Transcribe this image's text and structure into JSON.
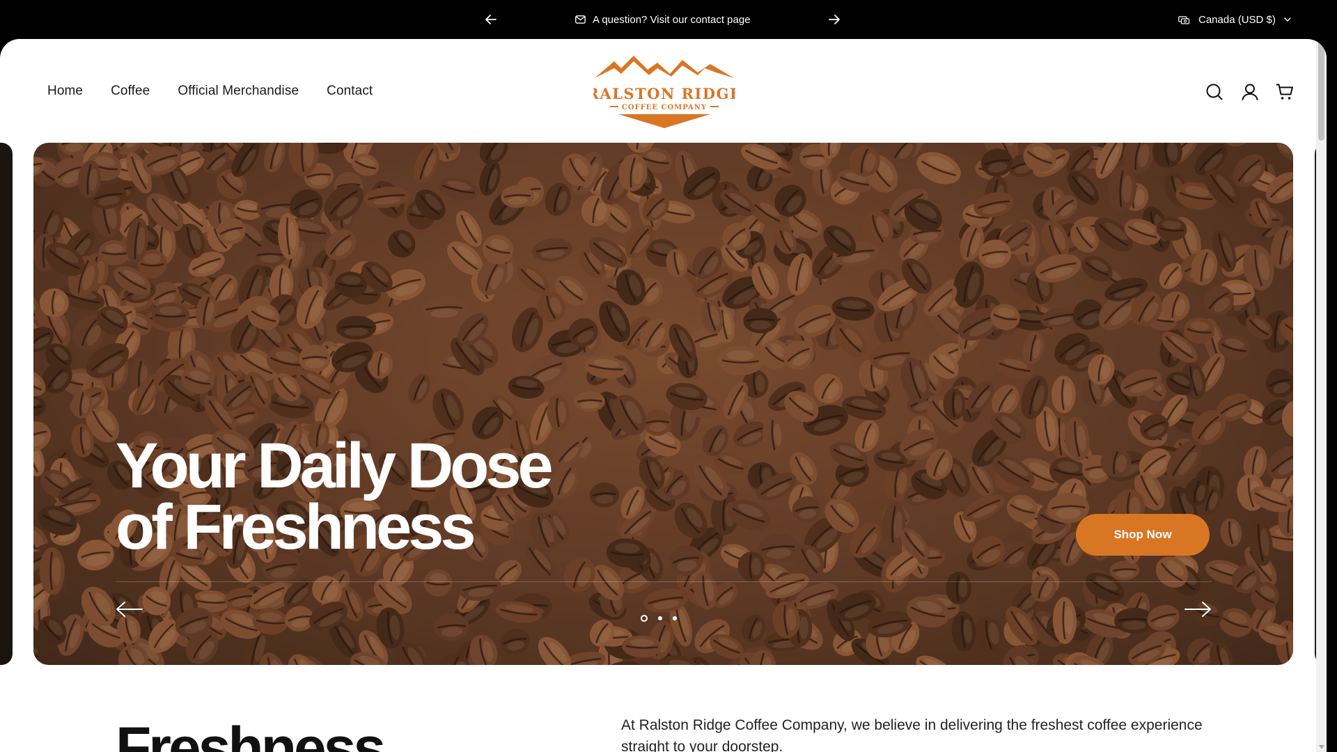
{
  "announcement": {
    "message": "A question? Visit our contact page",
    "message_icon": "mail-icon",
    "prev_icon": "arrow-left-icon",
    "next_icon": "arrow-right-icon",
    "currency": "Canada (USD $)",
    "currency_icon": "currency-icon"
  },
  "header": {
    "nav": [
      "Home",
      "Coffee",
      "Official Merchandise",
      "Contact"
    ],
    "logo": {
      "line1": "RALSTON RIDGE",
      "line2": "COFFEE COMPANY",
      "color": "#d87624"
    },
    "icons": [
      "search-icon",
      "account-icon",
      "cart-icon"
    ]
  },
  "hero": {
    "title": "Your Daily Dose\nof Freshness",
    "cta": "Shop Now",
    "cta_color": "#d87624",
    "slide_count": 3,
    "active_slide": 1
  },
  "intro": {
    "heading": "Freshness",
    "text": "At Ralston Ridge Coffee Company, we believe in delivering the freshest coffee experience straight to your doorstep."
  }
}
